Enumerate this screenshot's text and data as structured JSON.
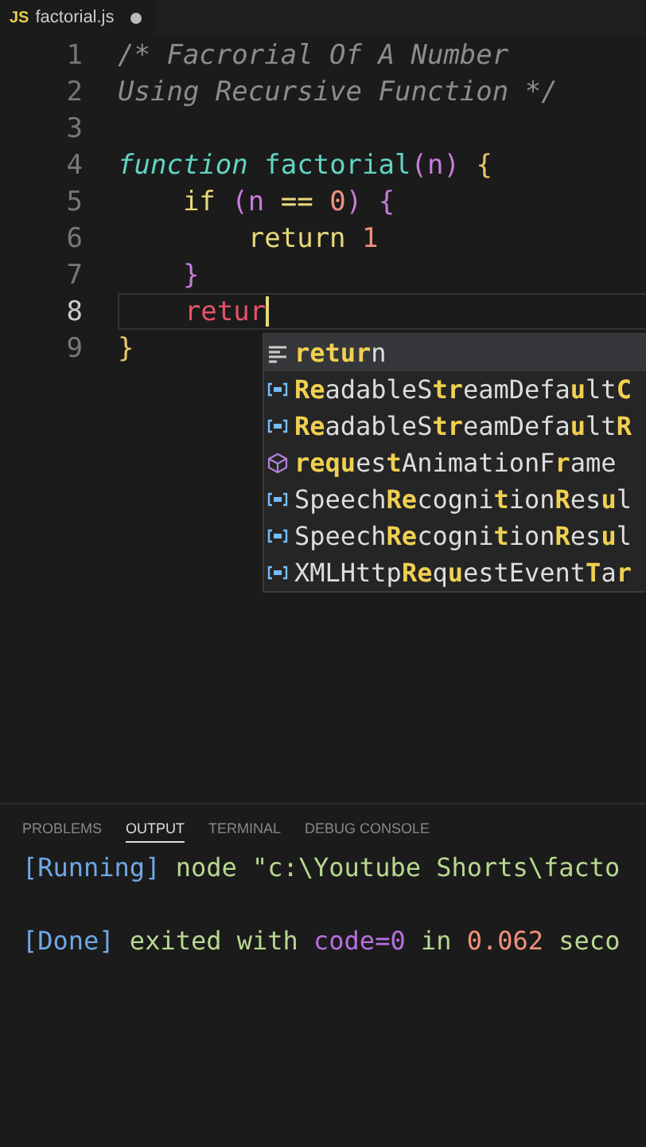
{
  "editor_tab": {
    "icon_text": "JS",
    "filename": "factorial.js",
    "modified": true
  },
  "lines": [
    {
      "number": "1",
      "tokens": [
        {
          "text": "/* Facrorial Of A Number",
          "kind": "comment"
        }
      ]
    },
    {
      "number": "2",
      "tokens": [
        {
          "text": "Using Recursive Function */",
          "kind": "comment"
        }
      ]
    },
    {
      "number": "3"
    },
    {
      "number": "4",
      "tokens": [
        {
          "text": "function",
          "kind": "storage"
        },
        {
          "text": " factorial",
          "kind": "func"
        },
        {
          "text": "(",
          "kind": "paren"
        },
        {
          "text": "n",
          "kind": "param"
        },
        {
          "text": ")",
          "kind": "paren"
        },
        {
          "text": " {",
          "kind": "brace"
        }
      ]
    },
    {
      "number": "5",
      "tokens": [
        {
          "text": "    if",
          "kind": "keyword"
        },
        {
          "text": " (",
          "kind": "paren"
        },
        {
          "text": "n",
          "kind": "param"
        },
        {
          "text": " == ",
          "kind": "operator"
        },
        {
          "text": "0",
          "kind": "number"
        },
        {
          "text": ") {",
          "kind": "paren"
        }
      ]
    },
    {
      "number": "6",
      "tokens": [
        {
          "text": "        return",
          "kind": "keyword"
        },
        {
          "text": " 1",
          "kind": "number"
        }
      ]
    },
    {
      "number": "7",
      "tokens": [
        {
          "text": "    }",
          "kind": "paren"
        }
      ]
    },
    {
      "number": "8",
      "current": true,
      "cursor": true,
      "tokens": [
        {
          "text": "    retur",
          "kind": "error"
        }
      ]
    },
    {
      "number": "9",
      "tokens": [
        {
          "text": "}",
          "kind": "brace"
        }
      ]
    }
  ],
  "suggestions": [
    {
      "kind": "keyword",
      "label": "**retur**n",
      "selected": true
    },
    {
      "kind": "variable",
      "label": "**Re**adableS**tr**eamDefa**u**lt**C**",
      "selected": false
    },
    {
      "kind": "variable",
      "label": "**Re**adableS**tr**eamDefa**u**lt**R**",
      "selected": false
    },
    {
      "kind": "method",
      "label": "**requ**es**t**AnimationF**r**ame",
      "selected": false
    },
    {
      "kind": "variable",
      "label": "Speech**Re**cogni**t**ion**R**es**u**l",
      "selected": false
    },
    {
      "kind": "variable",
      "label": "Speech**Re**cogni**t**ion**R**es**u**l",
      "selected": false
    },
    {
      "kind": "variable",
      "label": "XMLHttp**Re**q**u**estEvent**T**a**r**",
      "selected": false
    }
  ],
  "panel_tabs": [
    {
      "label": "PROBLEMS",
      "selected": false
    },
    {
      "label": "OUTPUT",
      "selected": true
    },
    {
      "label": "TERMINAL",
      "selected": false
    },
    {
      "label": "DEBUG CONSOLE",
      "selected": false
    }
  ],
  "output": [
    [
      {
        "text": "[Running]",
        "kind": "tag"
      },
      {
        "text": " node \"c:\\Youtube Shorts\\facto",
        "kind": "plain"
      }
    ],
    [
      {
        "text": "[Done]",
        "kind": "tag"
      },
      {
        "text": " exited with ",
        "kind": "plain"
      },
      {
        "text": "code=0",
        "kind": "code"
      },
      {
        "text": " in ",
        "kind": "plain"
      },
      {
        "text": "0.062",
        "kind": "number"
      },
      {
        "text": " seco",
        "kind": "plain"
      }
    ]
  ]
}
